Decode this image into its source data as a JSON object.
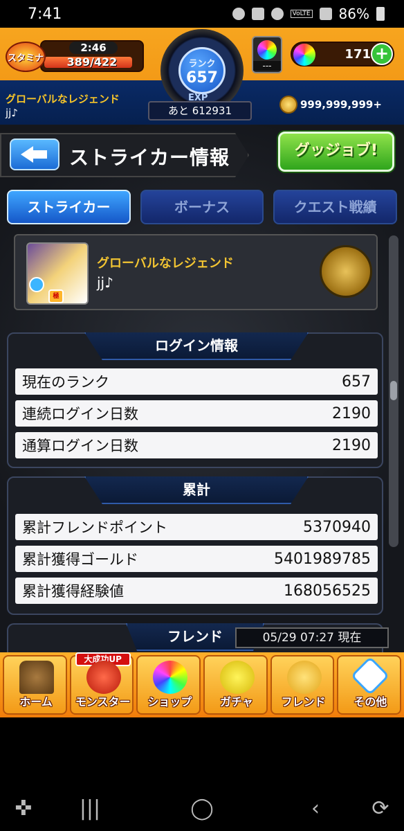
{
  "status_bar": {
    "time": "7:41",
    "battery": "86%",
    "network_label": "VoLTE"
  },
  "header": {
    "stamina_label": "スタミナ",
    "stamina_timer": "2:46",
    "stamina_value": "389/422",
    "stamina_fill": 0.92,
    "rank_label": "ランク",
    "rank_value": "657",
    "exp_label": "EXP",
    "exp_remaining": "あと 612931",
    "orb_button_label": "---",
    "orb_count": "171",
    "title": "グローバルなレジェンド",
    "name": "jj♪",
    "gold": "999,999,999+"
  },
  "page": {
    "title": "ストライカー情報",
    "goodjob_label": "グッジョブ!"
  },
  "tabs": [
    {
      "label": "ストライカー",
      "active": true
    },
    {
      "label": "ボーナス",
      "active": false
    },
    {
      "label": "クエスト戦績",
      "active": false
    }
  ],
  "profile": {
    "title": "グローバルなレジェンド",
    "name": "jj♪",
    "avatar_badge": "極"
  },
  "login_info": {
    "heading": "ログイン情報",
    "rows": [
      {
        "label": "現在のランク",
        "value": "657"
      },
      {
        "label": "連続ログイン日数",
        "value": "2190"
      },
      {
        "label": "通算ログイン日数",
        "value": "2190"
      }
    ]
  },
  "totals": {
    "heading": "累計",
    "rows": [
      {
        "label": "累計フレンドポイント",
        "value": "5370940"
      },
      {
        "label": "累計獲得ゴールド",
        "value": "5401989785"
      },
      {
        "label": "累計獲得経験値",
        "value": "168056525"
      }
    ]
  },
  "friend": {
    "heading": "フレンド",
    "timestamp": "05/29 07:27 現在"
  },
  "bottom_nav": [
    {
      "label": "ホーム",
      "icon": "home-icon"
    },
    {
      "label": "モンスター",
      "icon": "monster-icon",
      "badge": "大成功UP"
    },
    {
      "label": "ショップ",
      "icon": "shop-orb-icon"
    },
    {
      "label": "ガチャ",
      "icon": "gacha-icon"
    },
    {
      "label": "フレンド",
      "icon": "friend-icon"
    },
    {
      "label": "その他",
      "icon": "other-icon"
    }
  ],
  "colors": {
    "accent_orange": "#f39a17",
    "tab_active": "#1557c8",
    "title_gold": "#f3c532",
    "goodjob_green": "#2fa51c"
  }
}
